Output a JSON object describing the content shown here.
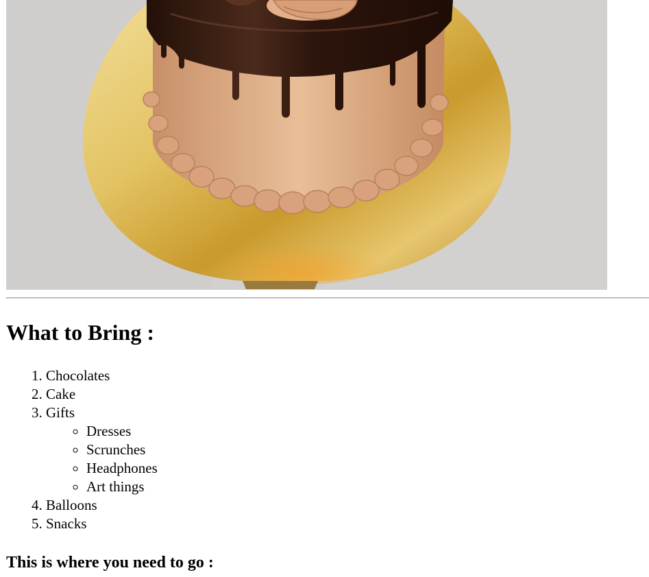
{
  "image": {
    "subject": "cake-photo",
    "colors": {
      "background": "#d3d2d0",
      "board_gold": "#d8b24a",
      "frosting": "#d9a77e",
      "chocolate": "#2e1710"
    }
  },
  "content": {
    "heading": "What to Bring :",
    "items": [
      {
        "label": "Chocolates"
      },
      {
        "label": "Cake"
      },
      {
        "label": "Gifts"
      },
      {
        "label": "Balloons"
      },
      {
        "label": "Snacks"
      }
    ],
    "gift_items": [
      {
        "label": "Dresses"
      },
      {
        "label": "Scrunches"
      },
      {
        "label": "Headphones"
      },
      {
        "label": "Art things"
      }
    ],
    "subheading": "This is where you need to go :"
  }
}
